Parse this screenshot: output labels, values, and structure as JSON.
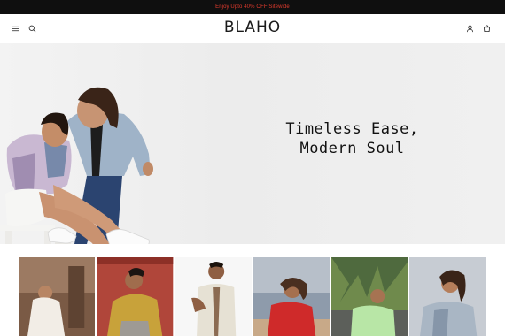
{
  "announcement": {
    "text": "Enjoy Upto 40% OFF Sitewide"
  },
  "header": {
    "logo": "BLAHO",
    "icons": [
      "menu-icon",
      "search-icon",
      "account-icon",
      "cart-icon"
    ]
  },
  "hero": {
    "title_line1": "Timeless Ease,",
    "title_line2": "Modern Soul"
  },
  "colors": {
    "announcement_bg": "#0f0f0f",
    "announcement_text": "#e23b2e",
    "hero_bg": "#efefef"
  }
}
